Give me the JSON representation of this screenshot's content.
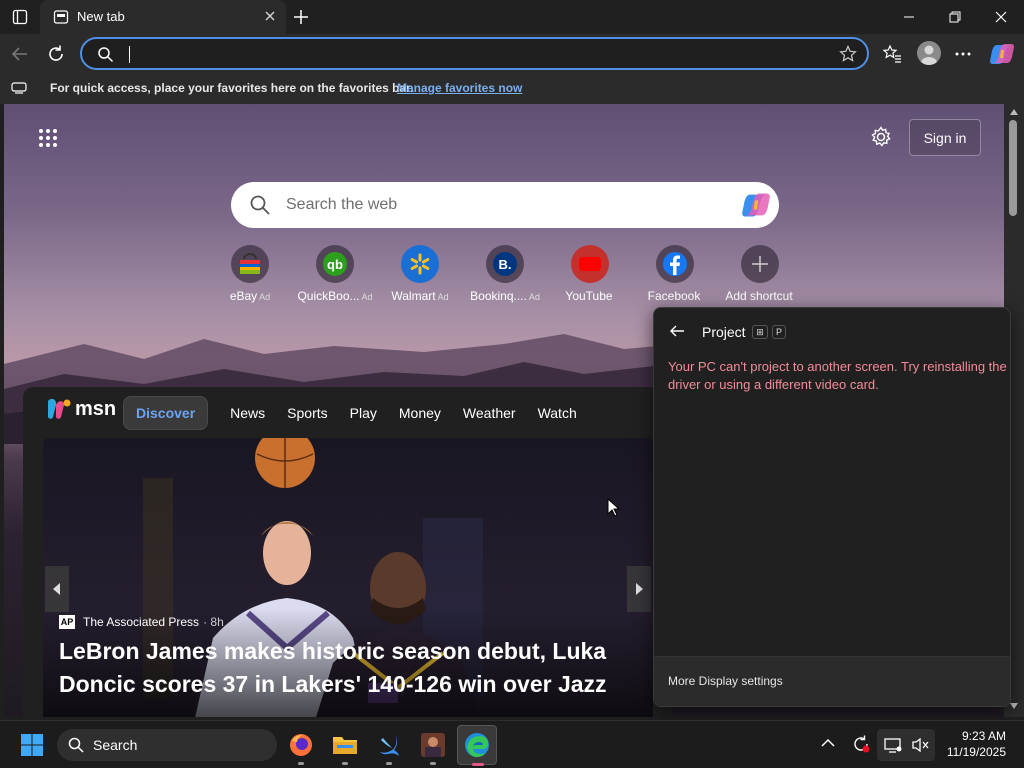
{
  "browser": {
    "tab_title": "New tab",
    "address_value": "",
    "favorites_message": "For quick access, place your favorites here on the favorites bar.",
    "favorites_link": "Manage favorites now"
  },
  "newtab": {
    "sign_in": "Sign in",
    "search_placeholder": "Search the web",
    "shortcuts": [
      {
        "label": "eBay",
        "ad": "Ad",
        "icon": "ebay-icon"
      },
      {
        "label": "QuickBoo...",
        "ad": "Ad",
        "icon": "quickbooks-icon"
      },
      {
        "label": "Walmart",
        "ad": "Ad",
        "icon": "walmart-icon"
      },
      {
        "label": "Bookinq....",
        "ad": "Ad",
        "icon": "booking-icon"
      },
      {
        "label": "YouTube",
        "ad": "",
        "icon": "youtube-icon"
      },
      {
        "label": "Facebook",
        "ad": "",
        "icon": "facebook-icon"
      },
      {
        "label": "Add shortcut",
        "ad": "",
        "icon": "plus-icon"
      }
    ]
  },
  "feed": {
    "brand": "msn",
    "nav": [
      "Discover",
      "News",
      "Sports",
      "Play",
      "Money",
      "Weather",
      "Watch"
    ],
    "source": "The Associated Press",
    "source_logo": "AP",
    "time": "· 8h",
    "headline": "LeBron James makes historic season debut, Luka Doncic scores 37 in Lakers' 140-126 win over Jazz"
  },
  "project_panel": {
    "title": "Project",
    "key1": "⊞",
    "key2": "P",
    "error": "Your PC can't project to another screen. Try reinstalling the driver or using a different video card.",
    "more_settings": "More Display settings"
  },
  "taskbar": {
    "search": "Search",
    "time": "9:23 AM",
    "date": "11/19/2025"
  },
  "colors": {
    "accent": "#4f8fe6",
    "error_text": "#f28b9a",
    "link": "#7ab0f0"
  }
}
